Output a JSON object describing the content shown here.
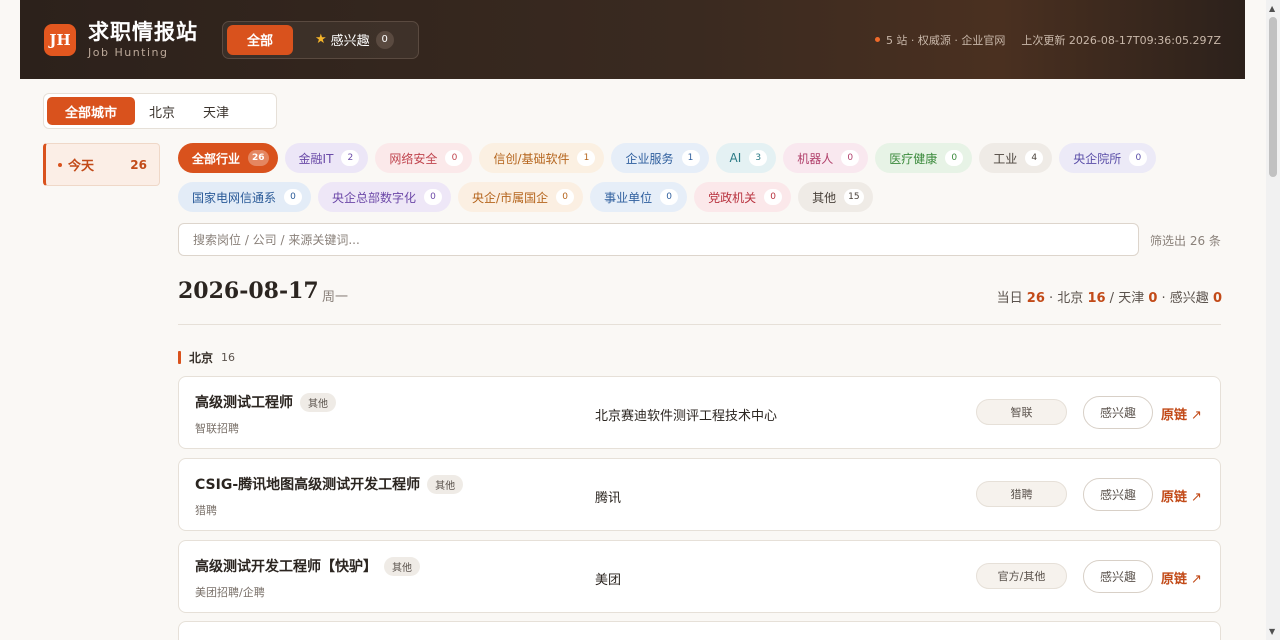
{
  "header": {
    "logo": "JH",
    "title": "求职情报站",
    "subtitle": "Job Hunting",
    "tab_all": "全部",
    "tab_fav": "感兴趣",
    "fav_count": "0",
    "stats": "5 站 · 权威源 · 企业官网",
    "updated": "上次更新 2026-08-17T09:36:05.297Z"
  },
  "cities": [
    {
      "label": "全部城市",
      "active": true
    },
    {
      "label": "北京",
      "active": false
    },
    {
      "label": "天津",
      "active": false
    }
  ],
  "date_nav": {
    "label": "今天",
    "count": "26"
  },
  "industries": [
    {
      "label": "全部行业",
      "count": "26",
      "active": true,
      "bg": "#d9521d",
      "fg": "#ffffff"
    },
    {
      "label": "金融IT",
      "count": "2",
      "bg": "#ece6f7",
      "fg": "#6a4aa8"
    },
    {
      "label": "网络安全",
      "count": "0",
      "bg": "#fbe9ea",
      "fg": "#c0454f"
    },
    {
      "label": "信创/基础软件",
      "count": "1",
      "bg": "#fbf0e2",
      "fg": "#b5651d"
    },
    {
      "label": "企业服务",
      "count": "1",
      "bg": "#e6eef8",
      "fg": "#2f5f9e"
    },
    {
      "label": "AI",
      "count": "3",
      "bg": "#e4f1f3",
      "fg": "#2a7a85"
    },
    {
      "label": "机器人",
      "count": "0",
      "bg": "#f9e8ef",
      "fg": "#b1406b"
    },
    {
      "label": "医疗健康",
      "count": "0",
      "bg": "#e7f3e6",
      "fg": "#3b8a3c"
    },
    {
      "label": "工业",
      "count": "4",
      "bg": "#efebe6",
      "fg": "#4a423b"
    },
    {
      "label": "央企院所",
      "count": "0",
      "bg": "#eceaf7",
      "fg": "#5a4ea8"
    },
    {
      "label": "国家电网信通系",
      "count": "0",
      "bg": "#e3ecf7",
      "fg": "#2a5a98"
    },
    {
      "label": "央企总部数字化",
      "count": "0",
      "bg": "#eee7f7",
      "fg": "#6c48a8"
    },
    {
      "label": "央企/市属国企",
      "count": "0",
      "bg": "#fbefe2",
      "fg": "#b5651d"
    },
    {
      "label": "事业单位",
      "count": "0",
      "bg": "#e6eef8",
      "fg": "#2f5f9e"
    },
    {
      "label": "党政机关",
      "count": "0",
      "bg": "#fbe8ea",
      "fg": "#b8323e"
    },
    {
      "label": "其他",
      "count": "15",
      "bg": "#efebe6",
      "fg": "#4a423b"
    }
  ],
  "search": {
    "placeholder": "搜索岗位 / 公司 / 来源关键词...",
    "value": ""
  },
  "filter_result": "筛选出 26 条",
  "day": {
    "date": "2026-08-17",
    "weekday": "周一",
    "summary": {
      "day_label": "当日",
      "day_count": "26",
      "bj_label": "北京",
      "bj_count": "16",
      "tj_label": "天津",
      "tj_count": "0",
      "fav_label": "感兴趣",
      "fav_count": "0"
    }
  },
  "section": {
    "city": "北京",
    "count": "16"
  },
  "jobs": [
    {
      "title": "高级测试工程师",
      "tag": "其他",
      "source": "智联招聘",
      "company": "北京赛迪软件测评工程技术中心",
      "pill": "智联",
      "fav": "感兴趣",
      "link": "原链"
    },
    {
      "title": "CSIG-腾讯地图高级测试开发工程师",
      "tag": "其他",
      "source": "猎聘",
      "company": "腾讯",
      "pill": "猎聘",
      "fav": "感兴趣",
      "link": "原链"
    },
    {
      "title": "高级测试开发工程师【快驴】",
      "tag": "其他",
      "source": "美团招聘/企聘",
      "company": "美团",
      "pill": "官方/其他",
      "fav": "感兴趣",
      "link": "原链"
    }
  ],
  "colors": {
    "accent": "#d9521d",
    "header_bg": "#2c211b",
    "link": "#c24a18"
  }
}
